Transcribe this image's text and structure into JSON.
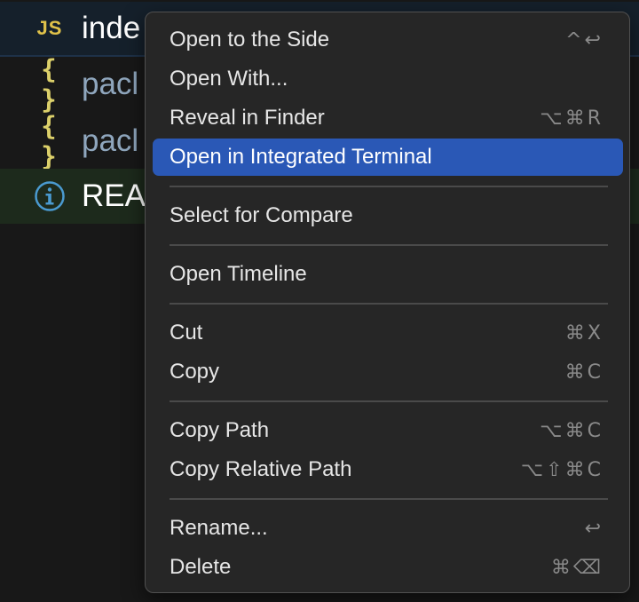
{
  "explorer": {
    "files": [
      {
        "icon": "JS",
        "name": "inde"
      },
      {
        "icon": "{ }",
        "name": "pacl"
      },
      {
        "icon": "{ }",
        "name": "pacl"
      },
      {
        "icon": "info-icon",
        "name": "REA"
      }
    ]
  },
  "context_menu": {
    "items": [
      {
        "label": "Open to the Side",
        "shortcut": "^↩"
      },
      {
        "label": "Open With...",
        "shortcut": ""
      },
      {
        "label": "Reveal in Finder",
        "shortcut": "⌥⌘R"
      },
      {
        "label": "Open in Integrated Terminal",
        "shortcut": ""
      },
      {
        "label": "Select for Compare",
        "shortcut": ""
      },
      {
        "label": "Open Timeline",
        "shortcut": ""
      },
      {
        "label": "Cut",
        "shortcut": "⌘X"
      },
      {
        "label": "Copy",
        "shortcut": "⌘C"
      },
      {
        "label": "Copy Path",
        "shortcut": "⌥⌘C"
      },
      {
        "label": "Copy Relative Path",
        "shortcut": "⌥⇧⌘C"
      },
      {
        "label": "Rename...",
        "shortcut": "↩"
      },
      {
        "label": "Delete",
        "shortcut": "⌘⌫"
      }
    ],
    "highlight_color": "#2a58b6"
  }
}
